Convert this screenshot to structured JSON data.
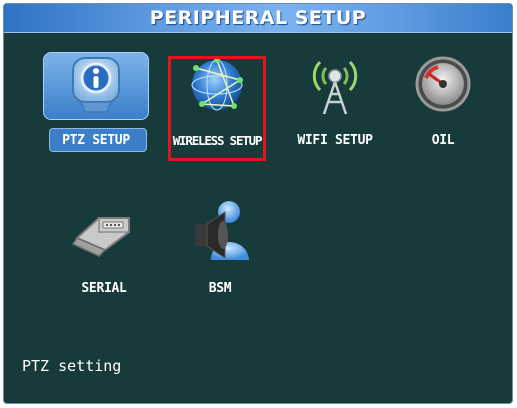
{
  "title": "PERIPHERAL  SETUP",
  "menu": {
    "items": [
      {
        "label": "PTZ SETUP",
        "icon": "ptz-camera-icon",
        "selected": true
      },
      {
        "label": "WIRELESS SETUP",
        "icon": "globe-network-icon",
        "highlighted": true
      },
      {
        "label": "WIFI SETUP",
        "icon": "antenna-tower-icon"
      },
      {
        "label": "OIL",
        "icon": "fuel-gauge-icon"
      },
      {
        "label": "SERIAL",
        "icon": "serial-connector-icon"
      },
      {
        "label": "BSM",
        "icon": "speaker-person-icon"
      }
    ]
  },
  "status_text": "PTZ setting",
  "colors": {
    "background": "#173a3a",
    "title_bar": "#5e9ae0",
    "selected_item": "#3c7fc8",
    "highlight_border": "#e0161b"
  }
}
